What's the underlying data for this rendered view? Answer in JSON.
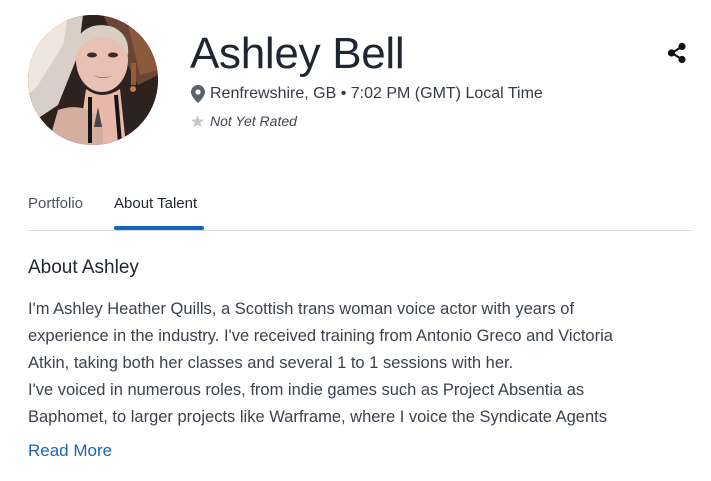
{
  "profile": {
    "name": "Ashley Bell",
    "location": "Renfrewshire, GB • 7:02 PM (GMT) Local Time",
    "rating_text": "Not Yet Rated"
  },
  "tabs": [
    {
      "label": "Portfolio",
      "active": false
    },
    {
      "label": "About Talent",
      "active": true
    }
  ],
  "about": {
    "title": "About Ashley",
    "bio_lines": [
      "I'm Ashley Heather Quills, a Scottish trans woman voice actor with years of",
      "experience in the industry. I've received training from Antonio Greco and Victoria",
      "Atkin, taking both her classes and several 1 to 1 sessions with her.",
      "I've voiced in numerous roles, from indie games such as Project Absentia as",
      "Baphomet, to larger projects like Warframe, where I voice the Syndicate Agents"
    ],
    "read_more": "Read More"
  },
  "colors": {
    "accent": "#1565c0",
    "link": "#1a64b8",
    "divider": "#d6d9dd",
    "star": "#c4c8cd"
  },
  "icons": {
    "share": "share-icon",
    "location": "map-pin-icon",
    "rating": "star-icon"
  }
}
